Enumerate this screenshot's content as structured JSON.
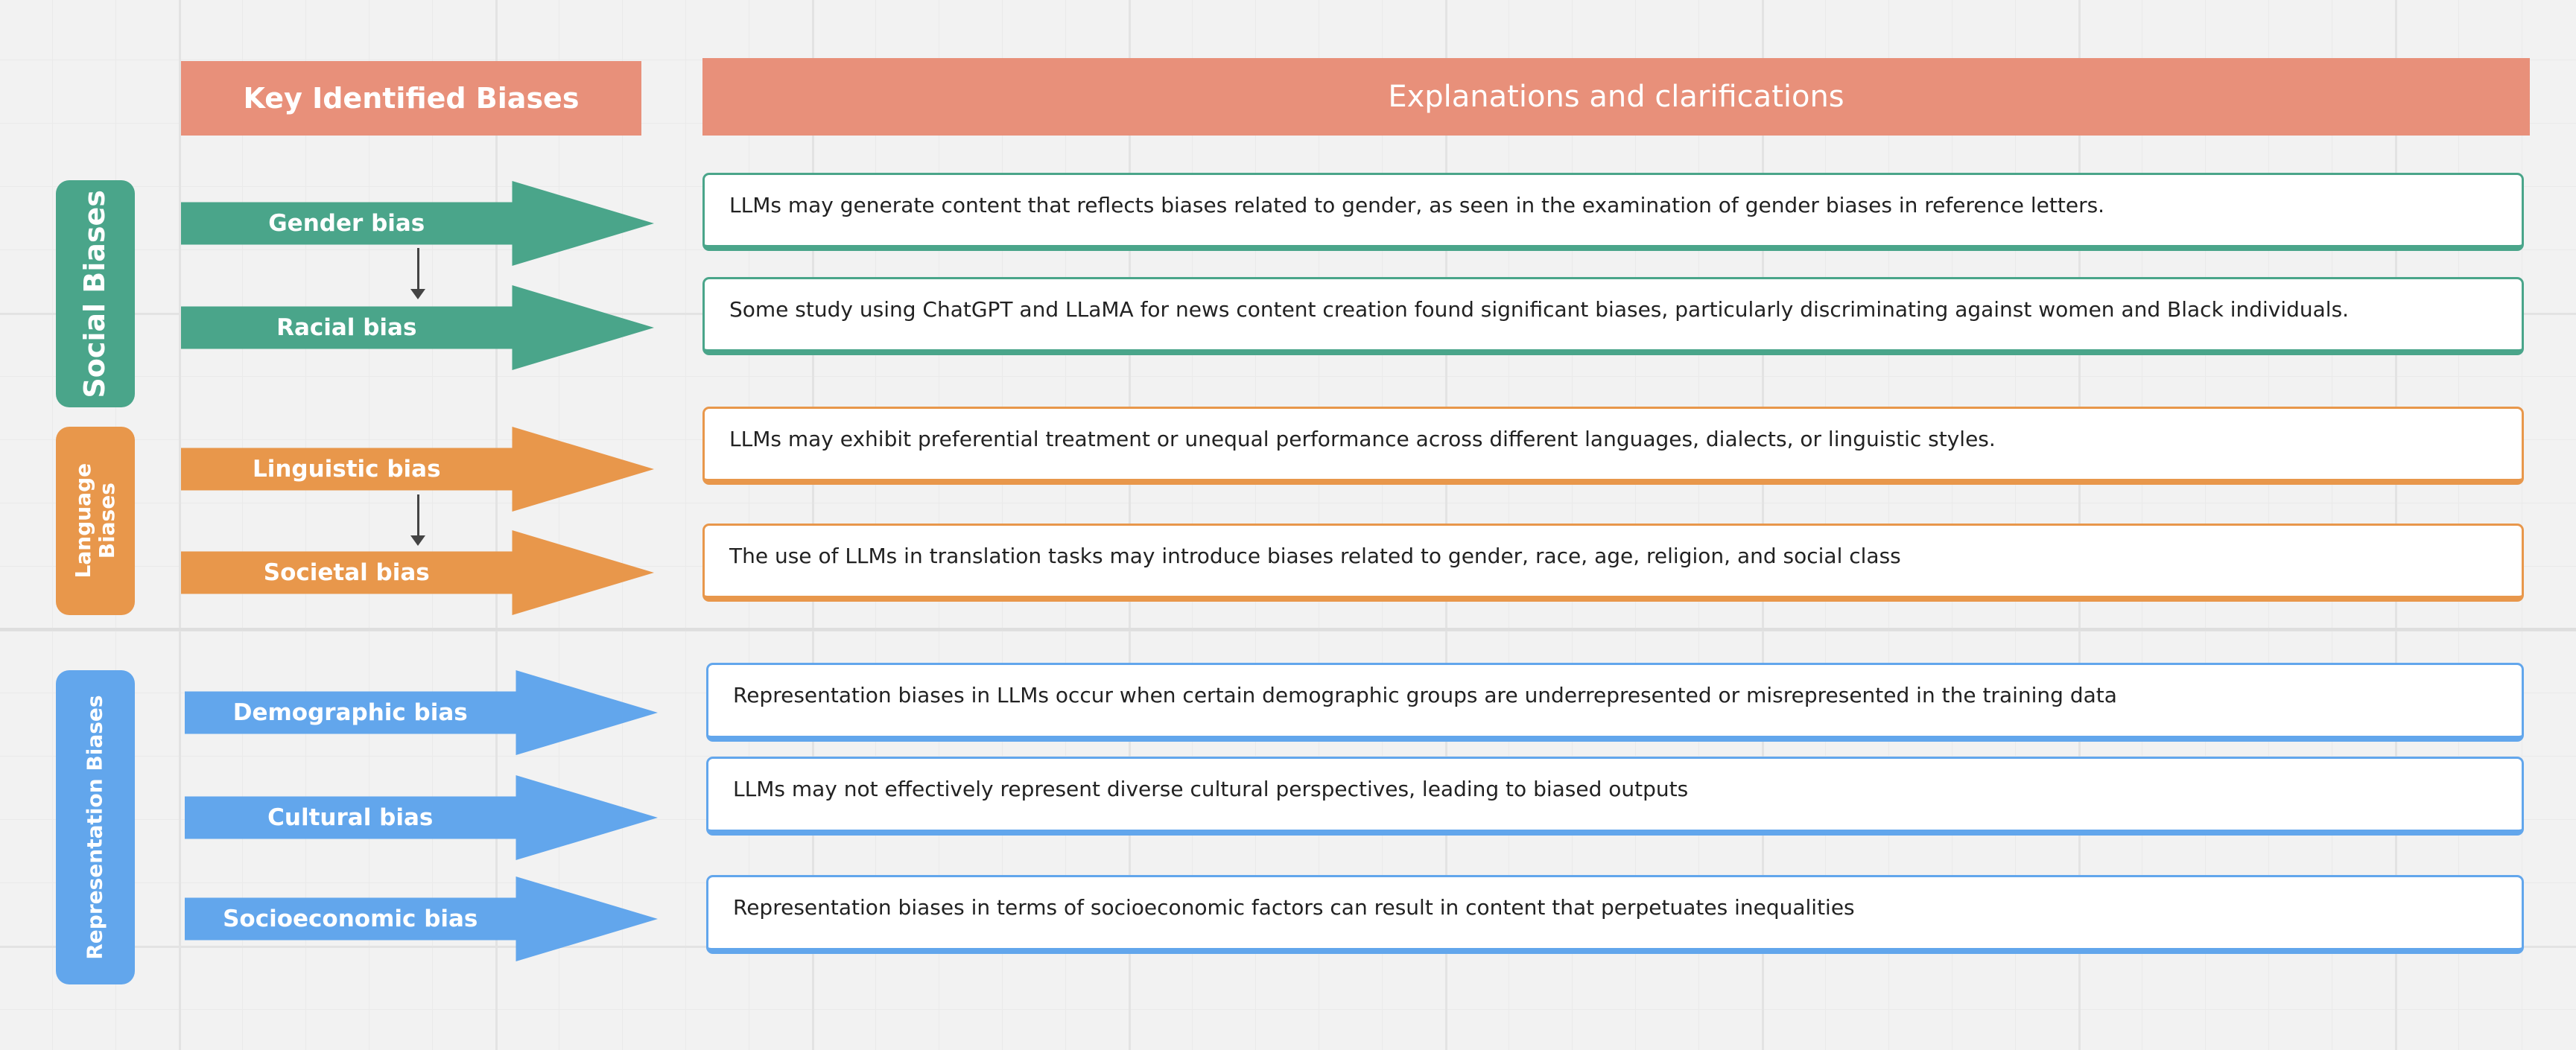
{
  "header": {
    "left_title": "Key Identified Biases",
    "right_title": "Explanations and clarifications"
  },
  "groups": {
    "social": "Social Biases",
    "language": "Language Biases",
    "representation": "Representation Biases"
  },
  "biases": [
    {
      "label": "Gender bias",
      "explanation": "LLMs may generate content that reflects biases related to gender, as seen in the examination of gender biases in reference letters."
    },
    {
      "label": "Racial bias",
      "explanation": "Some study using ChatGPT and LLaMA for news content creation found significant biases, particularly discriminating against women and Black individuals."
    },
    {
      "label": "Linguistic bias",
      "explanation": "LLMs may exhibit preferential treatment or unequal performance across different languages, dialects, or linguistic styles."
    },
    {
      "label": "Societal bias",
      "explanation": "The use of LLMs in translation tasks may introduce biases related to gender, race, age, religion, and social class"
    },
    {
      "label": "Demographic bias",
      "explanation": "Representation biases in LLMs occur when certain demographic groups are underrepresented or misrepresented in the training data"
    },
    {
      "label": "Cultural bias",
      "explanation": "LLMs may not effectively represent diverse cultural perspectives, leading to biased outputs"
    },
    {
      "label": "Socioeconomic bias",
      "explanation": "Representation biases in terms of socioeconomic factors can result in content that perpetuates inequalities"
    }
  ],
  "colors": {
    "header": "#e8907a",
    "social": "#4aa58a",
    "language": "#e8974b",
    "representation": "#62a6ec"
  }
}
